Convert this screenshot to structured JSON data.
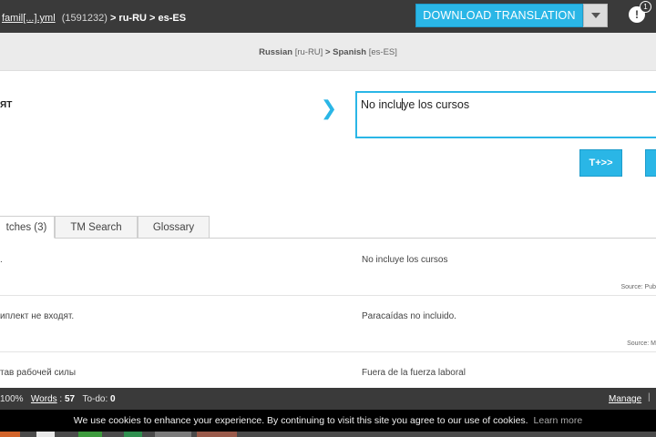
{
  "header": {
    "file_link": "famil[...].yml",
    "file_id": "(1591232)",
    "lang_path": "> ru-RU > es-ES",
    "download_label": "DOWNLOAD TRANSLATION",
    "notification_count": "1",
    "notification_glyph": "!"
  },
  "language_bar": {
    "source_name": "Russian",
    "source_code": "[ru-RU]",
    "arrow": ">",
    "target_name": "Spanish",
    "target_code": "[es-ES]"
  },
  "editor": {
    "source_text": "ЯТ",
    "arrow_glyph": "❯",
    "target_before_cursor": "No inclu",
    "target_after_cursor": "ye los cursos",
    "t_button_label": "T+>>"
  },
  "tabs": [
    {
      "label": "tches (3)"
    },
    {
      "label": "TM Search"
    },
    {
      "label": "Glossary"
    }
  ],
  "matches": [
    {
      "source": ".",
      "target": "No incluye los cursos",
      "note": "Source: Pub"
    },
    {
      "source": "иплект не входят.",
      "target": "Paracaídas no incluido.",
      "note": "Source: M"
    },
    {
      "source": "тав рабочей силы",
      "target": "Fuera de la fuerza laboral",
      "note": ""
    }
  ],
  "status": {
    "percent": "100%",
    "words_label": "Words",
    "words_sep": " : ",
    "words_value": "57",
    "todo_label": "To-do:",
    "todo_value": "0",
    "manage_label": "Manage",
    "sep": "|"
  },
  "cookie": {
    "message": "We use cookies to enhance your experience. By continuing to visit this site you agree to our use of cookies.",
    "learn_more": "Learn more"
  },
  "colors": {
    "accent": "#2ab6e6",
    "topbar": "#3a3a3a",
    "cookie_bg": "#000000"
  }
}
